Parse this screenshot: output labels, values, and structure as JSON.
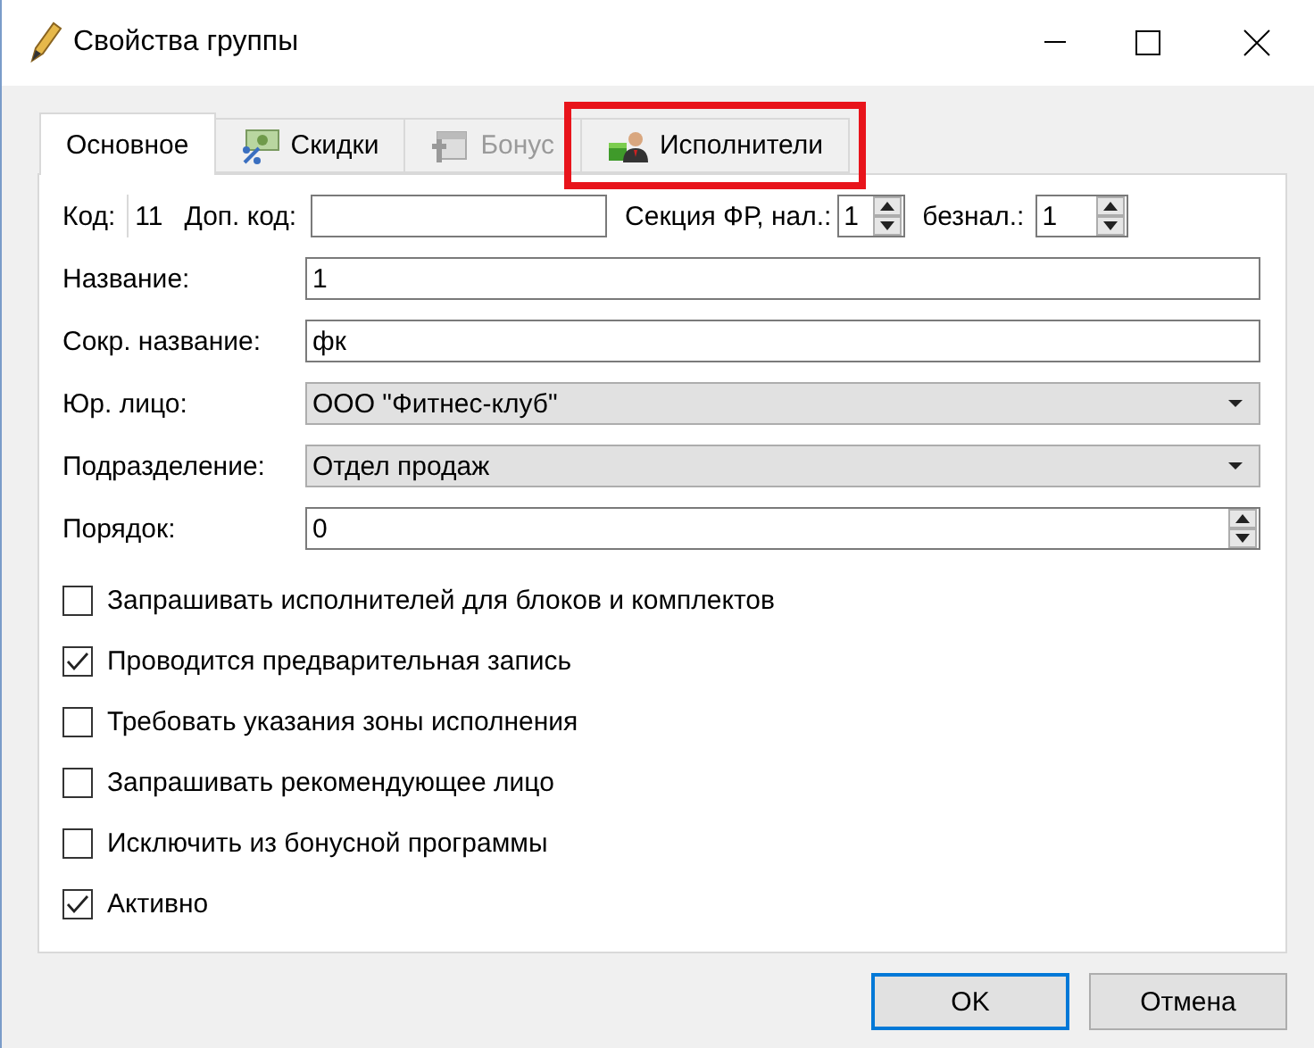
{
  "window": {
    "title": "Свойства группы"
  },
  "tabs": [
    {
      "label": "Основное",
      "selected": true,
      "disabled": false,
      "highlighted": false
    },
    {
      "label": "Скидки",
      "selected": false,
      "disabled": false,
      "highlighted": false
    },
    {
      "label": "Бонус",
      "selected": false,
      "disabled": true,
      "highlighted": false
    },
    {
      "label": "Исполнители",
      "selected": false,
      "disabled": false,
      "highlighted": true
    }
  ],
  "top_row": {
    "code_label": "Код:",
    "code_value": "11",
    "extra_code_label": "Доп. код:",
    "section_label": "Секция ФР, нал.:",
    "section_value": "1",
    "cashless_label": "безнал.:",
    "cashless_value": "1"
  },
  "fields": [
    {
      "label": "Название:",
      "value": "1",
      "kind": "text"
    },
    {
      "label": "Сокр. название:",
      "value": "фк",
      "kind": "text"
    },
    {
      "label": "Юр. лицо:",
      "value": "ООО \"Фитнес-клуб\"",
      "kind": "select"
    },
    {
      "label": "Подразделение:",
      "value": "Отдел продаж",
      "kind": "select"
    },
    {
      "label": "Порядок:",
      "value": "0",
      "kind": "spin"
    }
  ],
  "checkboxes": [
    {
      "label": "Запрашивать исполнителей для блоков и комплектов",
      "checked": false
    },
    {
      "label": "Проводится предварительная запись",
      "checked": true
    },
    {
      "label": "Требовать указания зоны исполнения",
      "checked": false
    },
    {
      "label": "Запрашивать рекомендующее лицо",
      "checked": false
    },
    {
      "label": "Исключить из бонусной программы",
      "checked": false
    },
    {
      "label": "Активно",
      "checked": true
    }
  ],
  "buttons": [
    {
      "label": "OK",
      "default": true
    },
    {
      "label": "Отмена",
      "default": false
    }
  ]
}
